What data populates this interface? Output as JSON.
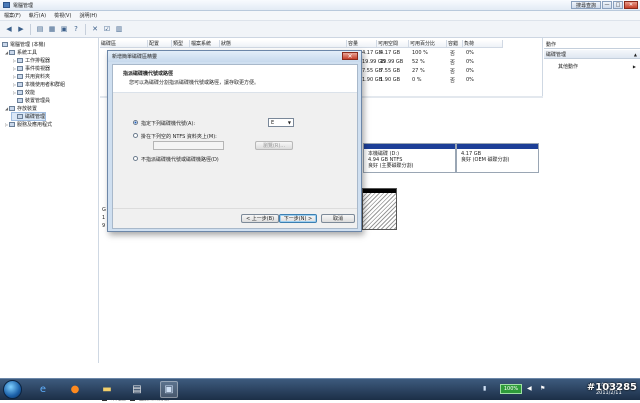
{
  "window": {
    "title": "電腦管理",
    "controls": {
      "search_label": "搜尋查詢",
      "minimize": "—",
      "maximize": "□",
      "close": "✕"
    }
  },
  "menubar": [
    "檔案(F)",
    "執行(A)",
    "檢視(V)",
    "說明(H)"
  ],
  "toolbar": {
    "icons": [
      "back-icon",
      "forward-icon",
      "up-icon",
      "show-hide-tree-icon",
      "properties-icon",
      "help-icon",
      "delete-icon",
      "check-icon",
      "more-icon"
    ]
  },
  "tree": {
    "root": "電腦管理 (本機)",
    "items": [
      {
        "label": "系統工具",
        "level": 1,
        "expanded": true
      },
      {
        "label": "工作排程器",
        "level": 2
      },
      {
        "label": "事件檢視器",
        "level": 2
      },
      {
        "label": "共用資料夾",
        "level": 2
      },
      {
        "label": "本機使用者和群組",
        "level": 2
      },
      {
        "label": "效能",
        "level": 2
      },
      {
        "label": "裝置管理員",
        "level": 2
      },
      {
        "label": "存放裝置",
        "level": 1,
        "expanded": true
      },
      {
        "label": "磁碟管理",
        "level": 2,
        "selected": true
      },
      {
        "label": "服務及應用程式",
        "level": 1
      }
    ]
  },
  "volume_table": {
    "headers": [
      "磁碟區",
      "配置",
      "類型",
      "檔案系統",
      "狀態",
      "容量",
      "可用空間",
      "可用百分比",
      "容錯",
      "負荷"
    ],
    "rows": [
      {
        "capacity": "4.17 GB",
        "free": "4.17 GB",
        "pct": "100 %",
        "ft": "否",
        "overhead": "0%"
      },
      {
        "capacity": "19.99 GB",
        "free": "19.99 GB",
        "pct": "52 %",
        "ft": "否",
        "overhead": "0%"
      },
      {
        "capacity": "7.55 GB",
        "free": "7.55 GB",
        "pct": "27 %",
        "ft": "否",
        "overhead": "0%"
      },
      {
        "capacity": "1.90 GB",
        "free": "1.90 GB",
        "pct": "0 %",
        "ft": "否",
        "overhead": "0%"
      }
    ]
  },
  "disk_area": {
    "part1": {
      "line1": "本機磁碟 (D:)",
      "line2": "4.94 GB NTFS",
      "line3": "良好 (主要磁碟分割)"
    },
    "part2": {
      "line1": "",
      "line2": "4.17 GB",
      "line3": "良好 (OEM 磁碟分割)"
    },
    "side_labels": [
      "G",
      "1",
      "9"
    ],
    "legend": [
      {
        "label": "未配置",
        "color": "#000000"
      },
      {
        "label": "主要磁碟分割",
        "color": "#1d3f97"
      }
    ]
  },
  "actions": {
    "header": "動作",
    "section": "磁碟管理",
    "items": [
      "其他動作"
    ]
  },
  "dialog": {
    "title": "新增簡單磁碟區精靈",
    "close_glyph": "✕",
    "heading": "指派磁碟機代號或路徑",
    "subheading": "您可以為磁碟分割指派磁碟機代號或路徑，讓存取更方便。",
    "options": [
      {
        "label": "指定下列磁碟機代號(A):",
        "selected": true
      },
      {
        "label": "掛在下列空的 NTFS 資料夾上(M):",
        "selected": false
      },
      {
        "label": "不指派磁碟機代號或磁碟機路徑(D)",
        "selected": false
      }
    ],
    "drive_letter": "E",
    "browse_label": "瀏覽(R)...",
    "path_value": "",
    "buttons": {
      "back": "< 上一步(B)",
      "next": "下一步(N) >",
      "cancel": "取消"
    }
  },
  "taskbar": {
    "battery_pct": "100%",
    "clock": "下午 07:28",
    "date": "2011/2/11"
  },
  "watermark": "#103285"
}
